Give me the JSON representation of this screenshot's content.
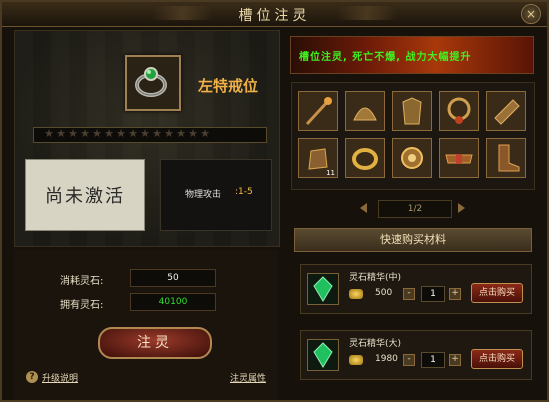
{
  "window": {
    "title": "槽位注灵",
    "close_label": "×"
  },
  "slot": {
    "name": "左特戒位",
    "icon": "ring-icon",
    "stars_total": 14,
    "stars_lit": 0
  },
  "status": {
    "inactive_label": "尚未激活"
  },
  "attribute": {
    "label": "物理攻击",
    "value": ":1-5"
  },
  "stones": {
    "cost_label": "消耗灵石:",
    "cost_value": "50",
    "owned_label": "拥有灵石:",
    "owned_value": "40100"
  },
  "inject_button": "注灵",
  "links": {
    "help": "升级说明",
    "help_icon": "?",
    "attrs": "注灵属性"
  },
  "banner": "槽位注灵, 死亡不爆, 战力大幅提升",
  "items_grid": {
    "badge": "11"
  },
  "pager": "1/2",
  "quick_buy": {
    "header": "快速购买材料",
    "items": [
      {
        "name": "灵石精华(中)",
        "price": "500",
        "qty": "1",
        "buy_label": "点击购买",
        "minus": "-",
        "plus": "+"
      },
      {
        "name": "灵石精华(大)",
        "price": "1980",
        "qty": "1",
        "buy_label": "点击购买",
        "minus": "-",
        "plus": "+"
      }
    ]
  },
  "colors": {
    "accent": "#f0b048",
    "banner_text": "#40f020",
    "gold_text": "#f0c040"
  }
}
